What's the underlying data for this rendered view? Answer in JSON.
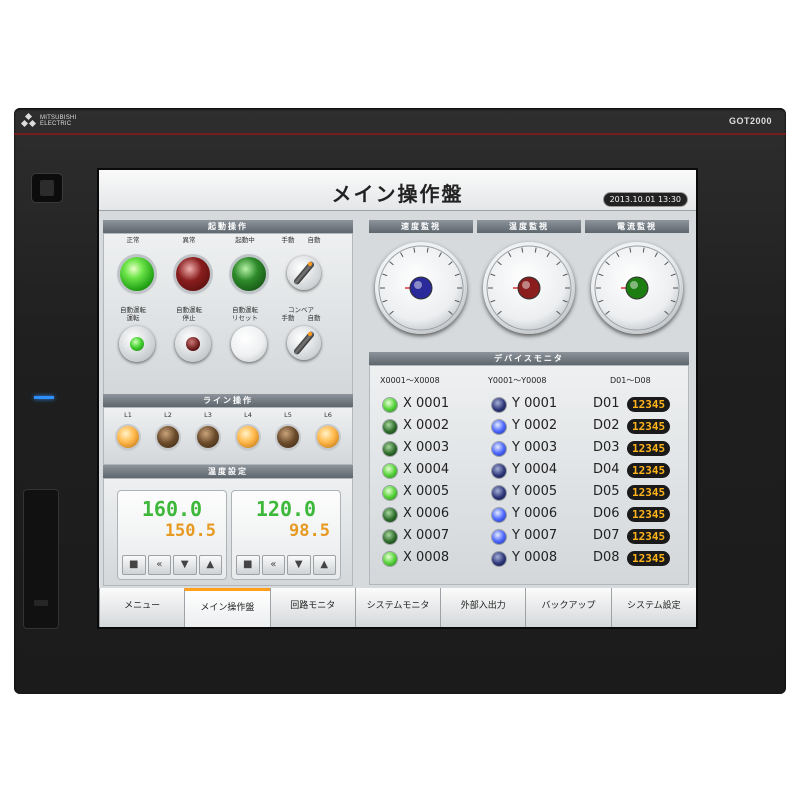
{
  "device": {
    "brand": "MITSUBISHI ELECTRIC",
    "model": "GOT2000"
  },
  "screen": {
    "title": "メイン操作盤",
    "datetime": "2013.10.01 13:30"
  },
  "start_ops": {
    "header": "起動操作",
    "row1": [
      {
        "label": "正常",
        "state": "green-on"
      },
      {
        "label": "異常",
        "state": "red"
      },
      {
        "label": "起動中",
        "state": "green-dim"
      },
      {
        "label": "手動　　自動",
        "state": "selector"
      }
    ],
    "row2": [
      {
        "label": "自動運転\n運転",
        "state": "button-green"
      },
      {
        "label": "自動運転\n停止",
        "state": "button-red"
      },
      {
        "label": "自動運転\nリセット",
        "state": "button-white"
      },
      {
        "label": "コンベア\n手動　　自動",
        "state": "selector"
      }
    ]
  },
  "line_ops": {
    "header": "ライン操作",
    "lamps": [
      {
        "label": "L1",
        "on": true
      },
      {
        "label": "L2",
        "on": false
      },
      {
        "label": "L3",
        "on": false
      },
      {
        "label": "L4",
        "on": true
      },
      {
        "label": "L5",
        "on": false
      },
      {
        "label": "L6",
        "on": true
      }
    ]
  },
  "temp_setting": {
    "header": "温度設定",
    "boxes": [
      {
        "pv": "160.0",
        "sv": "150.5"
      },
      {
        "pv": "120.0",
        "sv": "98.5"
      }
    ],
    "keys": [
      "■",
      "«",
      "▼",
      "▲"
    ]
  },
  "monitors": [
    {
      "header": "速度監視",
      "needle_color": "#2a2a9a"
    },
    {
      "header": "温度監視",
      "needle_color": "#8a1e1e"
    },
    {
      "header": "電流監視",
      "needle_color": "#1c7d11"
    }
  ],
  "device_monitor": {
    "header": "デバイスモニタ",
    "col_x": "X0001～X0008",
    "col_y": "Y0001～Y0008",
    "col_d": "D01～D08",
    "x": [
      {
        "label": "X 0001",
        "on": true
      },
      {
        "label": "X 0002",
        "on": false
      },
      {
        "label": "X 0003",
        "on": false
      },
      {
        "label": "X 0004",
        "on": true
      },
      {
        "label": "X 0005",
        "on": true
      },
      {
        "label": "X 0006",
        "on": false
      },
      {
        "label": "X 0007",
        "on": false
      },
      {
        "label": "X 0008",
        "on": true
      }
    ],
    "y": [
      {
        "label": "Y 0001",
        "on": false
      },
      {
        "label": "Y 0002",
        "on": true
      },
      {
        "label": "Y 0003",
        "on": true
      },
      {
        "label": "Y 0004",
        "on": false
      },
      {
        "label": "Y 0005",
        "on": false
      },
      {
        "label": "Y 0006",
        "on": true
      },
      {
        "label": "Y 0007",
        "on": true
      },
      {
        "label": "Y 0008",
        "on": false
      }
    ],
    "d": [
      {
        "label": "D01",
        "value": "12345"
      },
      {
        "label": "D02",
        "value": "12345"
      },
      {
        "label": "D03",
        "value": "12345"
      },
      {
        "label": "D04",
        "value": "12345"
      },
      {
        "label": "D05",
        "value": "12345"
      },
      {
        "label": "D06",
        "value": "12345"
      },
      {
        "label": "D07",
        "value": "12345"
      },
      {
        "label": "D08",
        "value": "12345"
      }
    ]
  },
  "nav": {
    "active": 1,
    "tabs": [
      "メニュー",
      "メイン操作盤",
      "回路モニタ",
      "システムモニタ",
      "外部入出力",
      "バックアップ",
      "システム設定"
    ]
  }
}
